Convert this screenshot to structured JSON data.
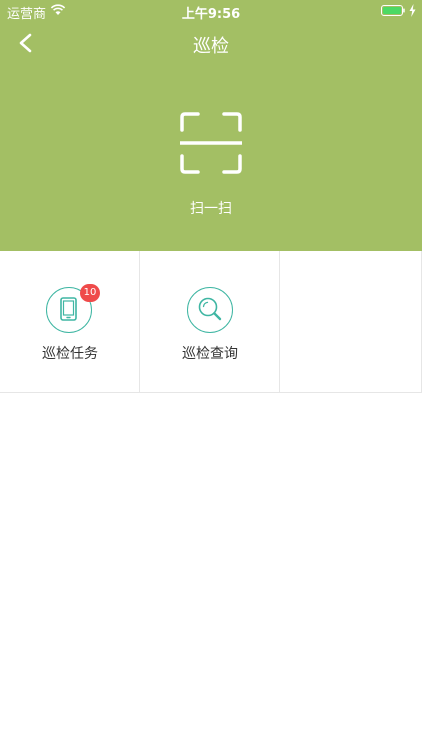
{
  "status_bar": {
    "carrier": "运营商",
    "time": "上午9:56"
  },
  "nav": {
    "title": "巡检"
  },
  "scan": {
    "label": "扫一扫"
  },
  "grid": {
    "items": [
      {
        "label": "巡检任务",
        "badge": "10"
      },
      {
        "label": "巡检查询"
      }
    ]
  },
  "colors": {
    "header_bg": "#a3bf64",
    "accent": "#3fb6a3",
    "badge": "#ef4a4a"
  }
}
